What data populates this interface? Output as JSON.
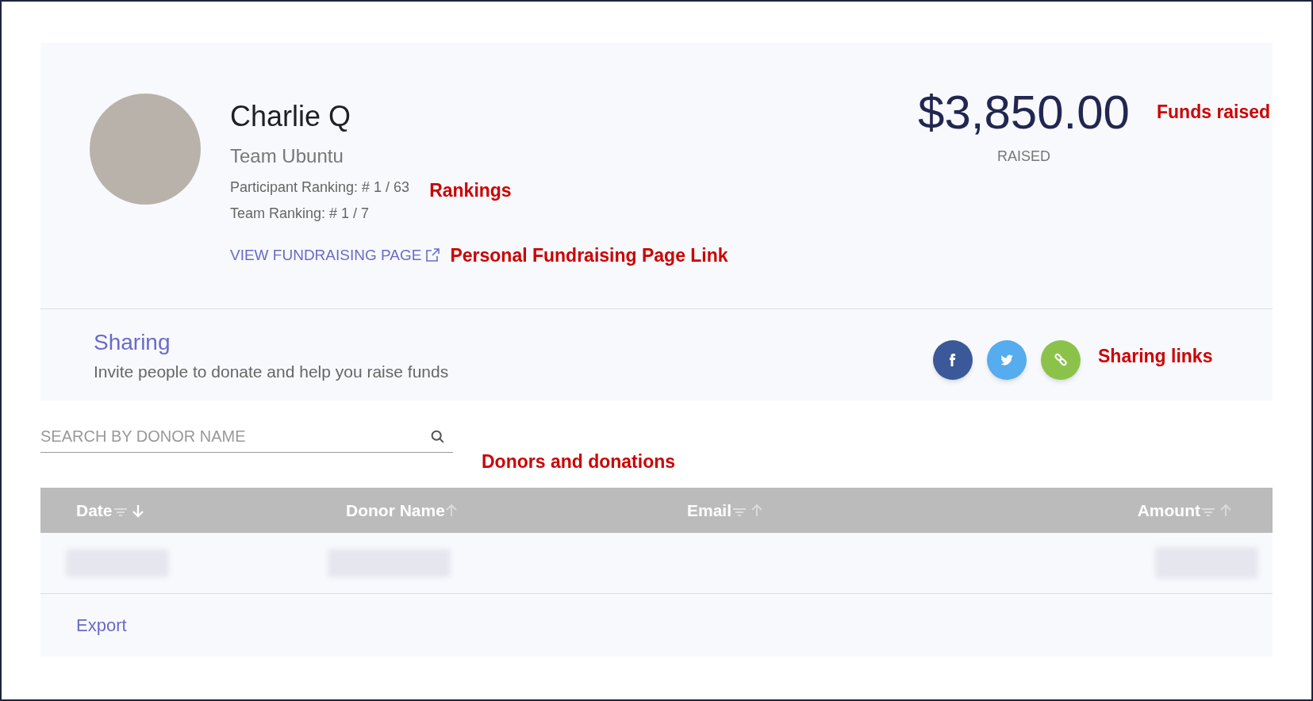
{
  "profile": {
    "name": "Charlie Q",
    "team": "Team Ubuntu",
    "rankings": [
      "Participant Ranking: # 1 / 63",
      "Team Ranking: # 1 / 7"
    ],
    "link": "VIEW FUNDRAISING PAGE"
  },
  "funds": {
    "amount": "$3,850.00",
    "label": "RAISED"
  },
  "sharing": {
    "title": "Sharing",
    "subtitle": "Invite people to donate and help you raise funds",
    "buttons": [
      {
        "kind": "facebook"
      },
      {
        "kind": "twitter"
      },
      {
        "kind": "link"
      }
    ]
  },
  "search": {
    "placeholder": "SEARCH BY DONOR NAME"
  },
  "table": {
    "columns": [
      {
        "label": "Date",
        "selected": true
      },
      {
        "label": "Donor Name",
        "selected": false
      },
      {
        "label": "Email",
        "selected": false
      },
      {
        "label": "Amount",
        "selected": false
      }
    ]
  },
  "export": "Export",
  "annotations": [
    {
      "kind": "rankings",
      "text": "Rankings"
    },
    {
      "kind": "link",
      "text": "Personal Fundraising Page Link"
    },
    {
      "kind": "funds",
      "text": "Funds raised"
    },
    {
      "kind": "sharing",
      "text": "Sharing links"
    },
    {
      "kind": "donors",
      "text": "Donors and donations"
    }
  ]
}
